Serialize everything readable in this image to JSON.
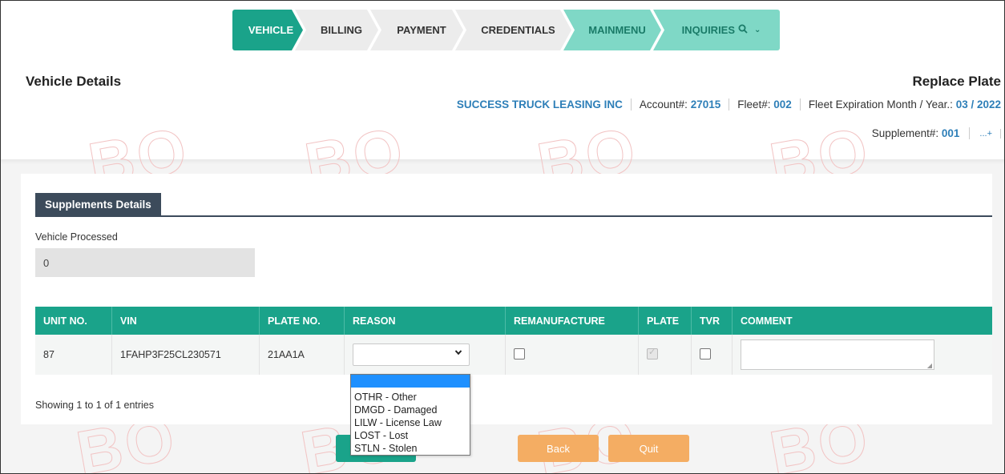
{
  "nav": {
    "steps": [
      {
        "label": "VEHICLE"
      },
      {
        "label": "BILLING"
      },
      {
        "label": "PAYMENT"
      },
      {
        "label": "CREDENTIALS"
      },
      {
        "label": "MAINMENU"
      },
      {
        "label": "INQUIRIES"
      }
    ],
    "active_color": "#1aa38a",
    "secondary_color": "#7fd8c6"
  },
  "header": {
    "title": "Vehicle Details",
    "action_title": "Replace Plate",
    "company": "SUCCESS TRUCK LEASING INC",
    "account_label": "Account#:",
    "account_value": "27015",
    "fleet_label": "Fleet#:",
    "fleet_value": "002",
    "expiration_label": "Fleet Expiration Month / Year.:",
    "expiration_value": "03 / 2022",
    "supplement_label": "Supplement#:",
    "supplement_value": "001",
    "more_label": "...+"
  },
  "watermark": {
    "text": "BO"
  },
  "supplements": {
    "tab_label": "Supplements Details",
    "vehicle_processed_label": "Vehicle Processed",
    "vehicle_processed_value": "0"
  },
  "table": {
    "columns": [
      "UNIT NO.",
      "VIN",
      "PLATE NO.",
      "REASON",
      "REMANUFACTURE",
      "PLATE",
      "TVR",
      "COMMENT"
    ],
    "rows": [
      {
        "unit_no": "87",
        "vin": "1FAHP3F25CL230571",
        "plate_no": "21AA1A",
        "reason": "",
        "remanufacture": false,
        "plate": true,
        "tvr": false,
        "comment": ""
      }
    ],
    "footer": "Showing 1 to 1 of 1 entries"
  },
  "reason_dropdown": {
    "options": [
      "",
      "OTHR - Other",
      "DMGD - Damaged",
      "LILW - License Law",
      "LOST - Lost",
      "STLN - Stolen"
    ]
  },
  "buttons": {
    "refresh_partial": "esh",
    "back": "Back",
    "quit": "Quit"
  }
}
